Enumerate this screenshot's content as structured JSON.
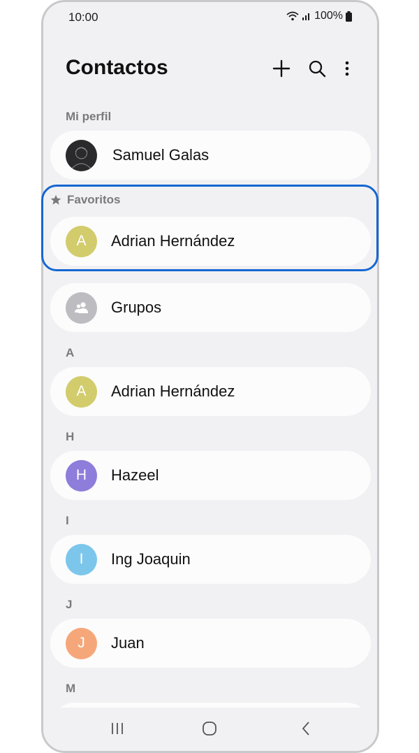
{
  "status_bar": {
    "time": "10:00",
    "battery": "100%"
  },
  "header": {
    "title": "Contactos"
  },
  "profile": {
    "section_label": "Mi perfil",
    "name": "Samuel Galas"
  },
  "favorites": {
    "section_label": "Favoritos",
    "contact": {
      "initial": "A",
      "name": "Adrian Hernández",
      "color": "#d2cc6c"
    }
  },
  "groups": {
    "label": "Grupos",
    "color": "#bdbdc1"
  },
  "contacts": [
    {
      "letter": "A",
      "initial": "A",
      "name": "Adrian Hernández",
      "color": "#d2cc6c"
    },
    {
      "letter": "H",
      "initial": "H",
      "name": "Hazeel",
      "color": "#8f7ddb"
    },
    {
      "letter": "I",
      "initial": "I",
      "name": "Ing Joaquin",
      "color": "#7cc6ec"
    },
    {
      "letter": "J",
      "initial": "J",
      "name": "Juan",
      "color": "#f6a77a"
    },
    {
      "letter": "M"
    }
  ],
  "icons": [
    "add-icon",
    "search-icon",
    "more-options-icon",
    "star-icon",
    "group-icon",
    "recents-icon",
    "home-icon",
    "back-icon"
  ],
  "accent_color": "#1567d3"
}
